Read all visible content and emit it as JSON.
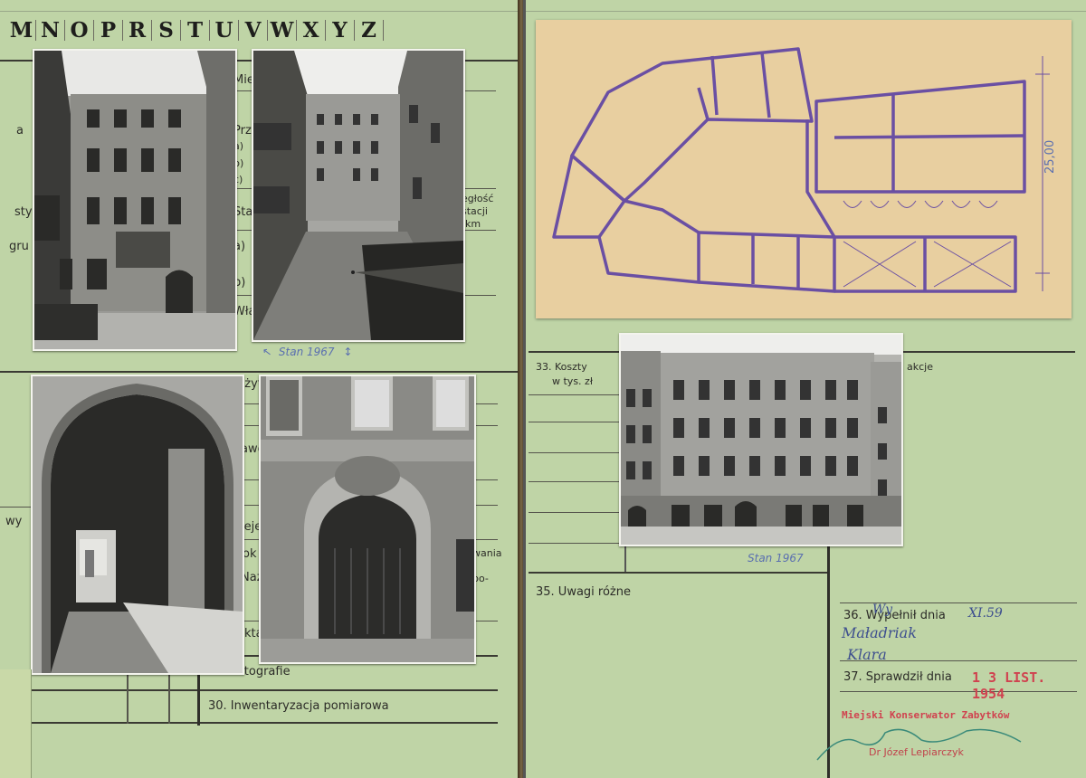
{
  "header": {
    "letters": [
      "M",
      "N",
      "O",
      "P",
      "R",
      "S",
      "T",
      "U",
      "V",
      "W",
      "X",
      "Y",
      "Z"
    ]
  },
  "left_page": {
    "fragments": {
      "mie": "Mie",
      "a": "a",
      "prz": "Prz",
      "a_paren": "a)",
      "b_paren": "b)",
      "c_paren": "c)",
      "sty": "sty",
      "gru": "gru",
      "sta": "Sta",
      "a2": "a)",
      "b2": "b)",
      "wla": "Wła",
      "odleglosc": "egłość",
      "stacji": "stacji",
      "km": "km",
      "uzy": "użyt",
      "awe": "awe",
      "wy": "wy",
      "ieje": "ieje",
      "ok": "ok",
      "nazw": "Nazw",
      "akta": "kta",
      "wania": "wania",
      "po": "po-",
      "r": "r",
      "f": "f"
    },
    "fields": {
      "fotografie": "29. Fotografie",
      "inwentaryzacja": "30. Inwentaryzacja pomiarowa"
    },
    "annotation": "Stan 1967"
  },
  "right_page": {
    "fields": {
      "koszty": "33. Koszty",
      "koszty_sub": "w tys. zł",
      "akcje": "akcje",
      "uwagi": "35. Uwagi różne",
      "wypelnil": "36. Wypełnił dnia",
      "sprawdzil": "37. Sprawdził dnia"
    },
    "plan": {
      "dimension": "25,00"
    },
    "photo_annotation": "Stan 1967",
    "handwritten": {
      "date": "XI.59",
      "name_line1": "Maładriak",
      "name_line2": "Klara",
      "wy_prefix": "Wy"
    },
    "stamp": {
      "date": "1 3 LIST. 1954",
      "office": "Miejski Konserwator Zabytków",
      "person": "Dr Józef Lepiarczyk"
    }
  },
  "colors": {
    "card": "#bfd4a6",
    "ink": "#2c2c28",
    "plan_ink": "#6a4fa3",
    "stamp_red": "#d0424f",
    "pencil_blue": "#5a6fb0"
  }
}
